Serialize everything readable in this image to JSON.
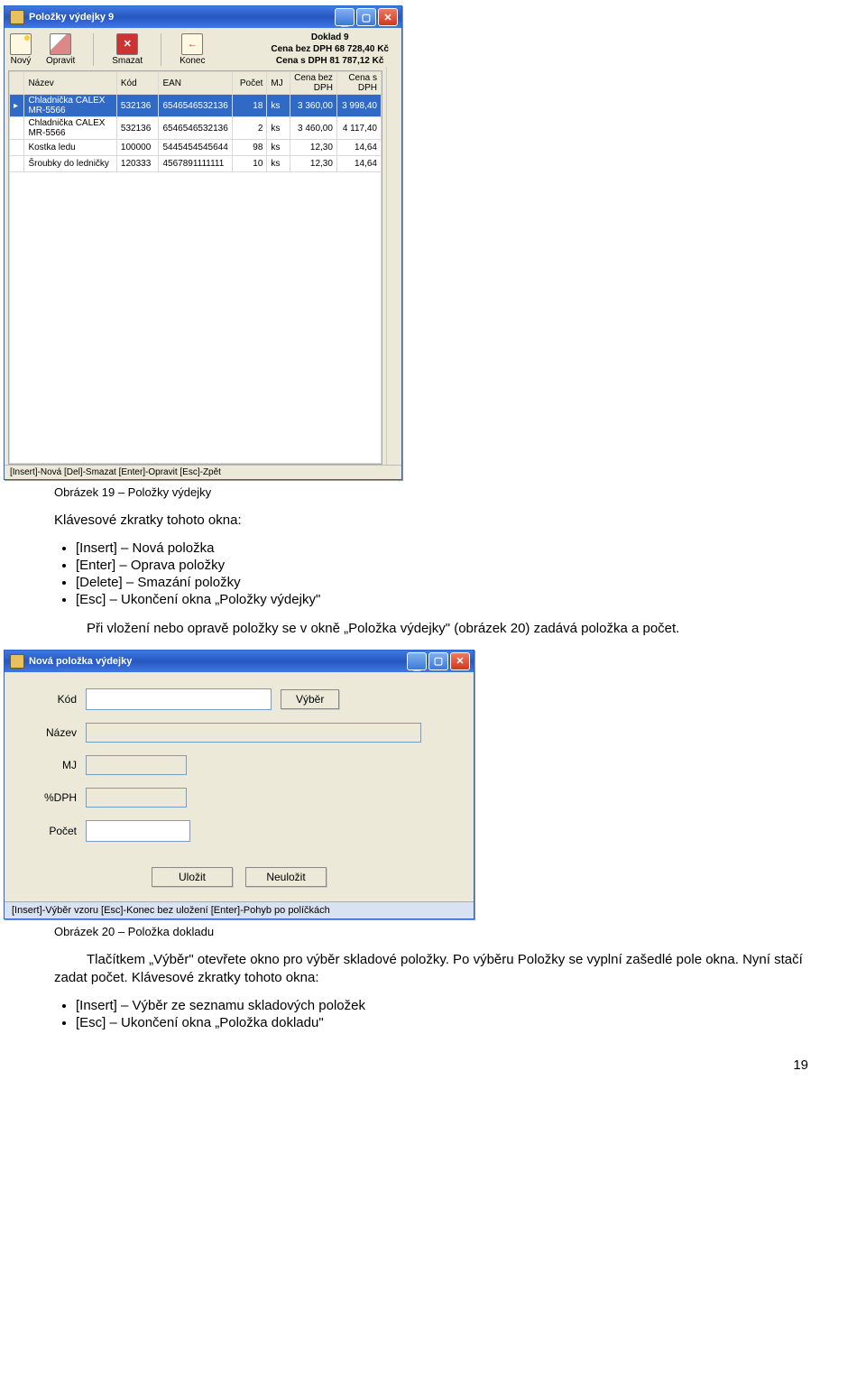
{
  "win1": {
    "title": "Položky výdejky 9",
    "toolbar": {
      "new": "Nový",
      "edit": "Opravit",
      "del": "Smazat",
      "end": "Konec"
    },
    "summary": {
      "line1": "Doklad 9",
      "line2": "Cena bez DPH 68 728,40 Kč",
      "line3": "Cena s DPH 81 787,12 Kč"
    },
    "cols": {
      "c0": "",
      "c1": "Název",
      "c2": "Kód",
      "c3": "EAN",
      "c4": "Počet",
      "c5": "MJ",
      "c6": "Cena bez DPH",
      "c7": "Cena s DPH"
    },
    "rows": [
      {
        "name": "Chladnička CALEX MR-5566",
        "kod": "532136",
        "ean": "6546546532136",
        "pocet": "18",
        "mj": "ks",
        "bez": "3 360,00",
        "s": "3 998,40"
      },
      {
        "name": "Chladnička CALEX MR-5566",
        "kod": "532136",
        "ean": "6546546532136",
        "pocet": "2",
        "mj": "ks",
        "bez": "3 460,00",
        "s": "4 117,40"
      },
      {
        "name": "Kostka ledu",
        "kod": "100000",
        "ean": "5445454545644",
        "pocet": "98",
        "mj": "ks",
        "bez": "12,30",
        "s": "14,64"
      },
      {
        "name": "Šroubky do ledničky",
        "kod": "120333",
        "ean": "4567891111111",
        "pocet": "10",
        "mj": "ks",
        "bez": "12,30",
        "s": "14,64"
      }
    ],
    "status": "[Insert]-Nová  [Del]-Smazat  [Enter]-Opravit  [Esc]-Zpět"
  },
  "label1": "Obrázek 19 – Položky výdejky",
  "txt1": "Klávesové zkratky tohoto okna:",
  "list1": [
    "[Insert] – Nová položka",
    "[Enter] – Oprava položky",
    "[Delete] – Smazání položky",
    "[Esc] – Ukončení okna „Položky výdejky\""
  ],
  "txt2": "Při vložení nebo opravě položky se v okně „Položka výdejky\" (obrázek 20) zadává položka a počet.",
  "win2": {
    "title": "Nová položka výdejky",
    "labels": {
      "kod": "Kód",
      "nazev": "Název",
      "mj": "MJ",
      "dph": "%DPH",
      "pocet": "Počet"
    },
    "btn_vyber": "Výběr",
    "btn_save": "Uložit",
    "btn_cancel": "Neuložit",
    "status": "[Insert]-Výběr vzoru  [Esc]-Konec bez uložení  [Enter]-Pohyb po políčkách"
  },
  "label2": "Obrázek 20 – Položka dokladu",
  "txt3": "Tlačítkem „Výběr\" otevřete okno pro výběr skladové položky. Po výběru Položky se vyplní zašedlé pole okna. Nyní stačí zadat počet. Klávesové zkratky tohoto okna:",
  "list2": [
    "[Insert] – Výběr ze seznamu skladových položek",
    "[Esc] – Ukončení okna „Položka dokladu\""
  ],
  "pagenum": "19"
}
